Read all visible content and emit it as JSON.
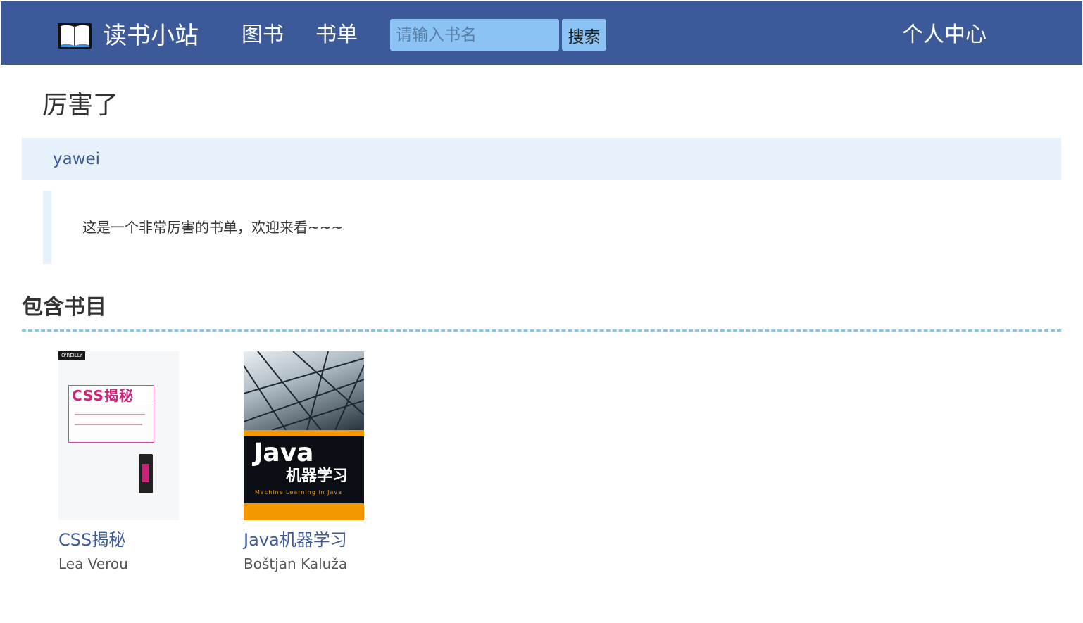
{
  "header": {
    "brand_name": "读书小站",
    "nav": {
      "books_label": "图书",
      "lists_label": "书单",
      "profile_label": "个人中心"
    },
    "search": {
      "placeholder": "请输入书名",
      "value": "",
      "button_label": "搜索"
    },
    "color": "#3c5a99"
  },
  "booklist": {
    "title": "厉害了",
    "author": "yawei",
    "description": "这是一个非常厉害的书单，欢迎来看~~~"
  },
  "books_section": {
    "title": "包含书目",
    "books": [
      {
        "title": "CSS揭秘",
        "author": "Lea Verou",
        "cover": {
          "publisher_badge": "O'REILLY",
          "banner_text": "CSS揭秘"
        }
      },
      {
        "title": "Java机器学习",
        "author": "Boštjan Kaluža",
        "cover": {
          "main_word": "Java",
          "cn_word": "机器学习",
          "subtitle": "Machine Learning in Java"
        }
      }
    ]
  }
}
